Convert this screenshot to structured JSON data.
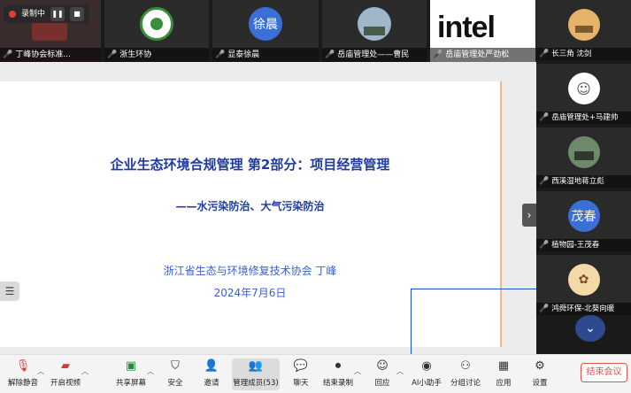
{
  "recording": {
    "label": "录制中"
  },
  "top_participants": [
    {
      "name": "丁峰协会标准...",
      "initials": ""
    },
    {
      "name": "浙生环协",
      "initials": ""
    },
    {
      "name": "显泰徐晨",
      "initials": "徐晨"
    },
    {
      "name": "岳庙管理处——曹民",
      "initials": ""
    },
    {
      "name": "岳庙管理处严劲松",
      "initials": "intel"
    }
  ],
  "right_participants": [
    {
      "name": "长三角 沈剑",
      "initials": ""
    },
    {
      "name": "岳庙管理处+马建帅",
      "initials": ""
    },
    {
      "name": "西溪湿地蒋立彪",
      "initials": ""
    },
    {
      "name": "植物园-王茂春",
      "initials": "茂春"
    },
    {
      "name": "鸿舜环保-北葵向暖",
      "initials": ""
    }
  ],
  "slide": {
    "title": "企业生态环境合规管理   第2部分：项目经营管理",
    "subtitle": "——水污染防治、大气污染防治",
    "organization": "浙江省生态与环境修复技术协会 丁峰",
    "date": "2024年7月6日"
  },
  "toolbar": {
    "unmute": "解除静音",
    "video": "开启视频",
    "share": "共享屏幕",
    "security": "安全",
    "invite": "邀请",
    "members": "管理成员(53)",
    "chat": "聊天",
    "end_record": "结束录制",
    "react": "回应",
    "ai": "AI小助手",
    "breakout": "分组讨论",
    "apps": "应用",
    "settings": "设置",
    "end_meeting": "结束会议"
  },
  "colors": {
    "slide_text": "#1f3b9f",
    "end_button": "#e0524e",
    "record_dot": "#e23b3b"
  }
}
